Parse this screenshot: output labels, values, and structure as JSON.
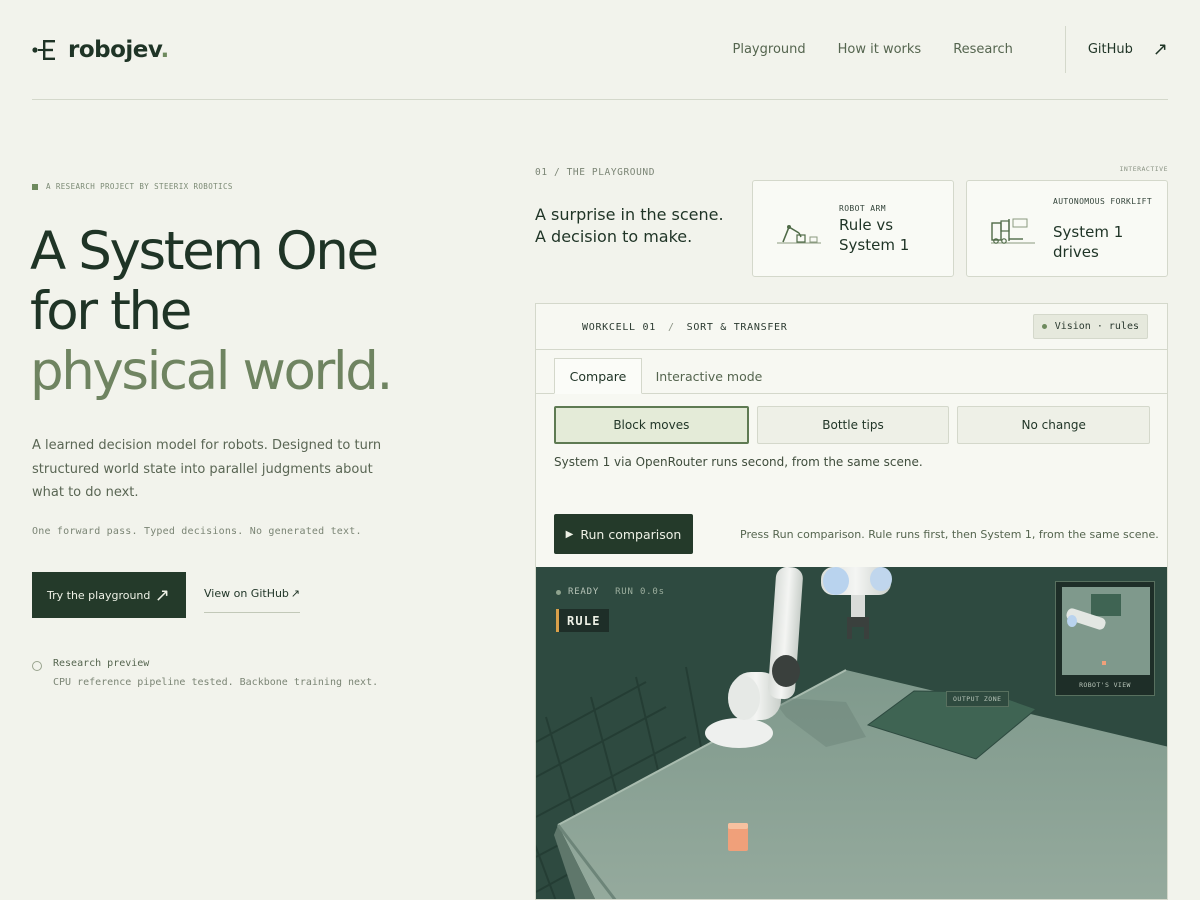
{
  "brand": {
    "name": "robojev",
    "dot": "."
  },
  "nav": {
    "items": [
      "Playground",
      "How it works",
      "Research"
    ],
    "github": "GitHub"
  },
  "hero": {
    "eyebrow": "A RESEARCH PROJECT BY STEERIX ROBOTICS",
    "title_line1": "A System One",
    "title_line2": "for the",
    "title_accent": "physical world.",
    "description": "A learned decision model for robots. Designed to turn structured world state into parallel judgments about what to do next.",
    "mono_note": "One forward pass. Typed decisions. No generated text.",
    "cta_primary": "Try the playground",
    "cta_secondary": "View on GitHub",
    "preview_title": "Research preview",
    "preview_note": "CPU reference pipeline tested. Backbone training next."
  },
  "playground": {
    "label": "01 / THE PLAYGROUND",
    "interactive_tag": "INTERACTIVE",
    "tagline_line1": "A surprise in the scene.",
    "tagline_line2": "A decision to make.",
    "cards": [
      {
        "kicker": "ROBOT ARM",
        "title": "Rule vs System 1",
        "icon": "robot-arm-icon"
      },
      {
        "kicker": "AUTONOMOUS FORKLIFT",
        "title": "System 1 drives",
        "icon": "forklift-icon"
      }
    ]
  },
  "workcell": {
    "id": "WORKCELL 01",
    "task": "SORT & TRANSFER",
    "badge": "Vision · rules",
    "tabs": [
      "Compare",
      "Interactive mode"
    ],
    "active_tab": "Compare",
    "choices": [
      "Block moves",
      "Bottle tips",
      "No change"
    ],
    "selected_choice": "Block moves",
    "note": "System 1 via OpenRouter runs second, from the same scene.",
    "run_label": "Run comparison",
    "run_hint": "Press Run comparison. Rule runs first, then System 1, from the same scene."
  },
  "scene": {
    "status": "READY",
    "run_time": "RUN 0.0s",
    "mode_tag": "RULE",
    "zone_label": "OUTPUT ZONE",
    "robot_view_label": "ROBOT'S VIEW"
  },
  "colors": {
    "background": "#f2f3ec",
    "ink": "#1f3426",
    "accent": "#6f8461",
    "button_dark": "#243a2a",
    "scene_floor": "#2e4a40",
    "rule_marker": "#d9a04a",
    "block": "#f0a07a"
  }
}
